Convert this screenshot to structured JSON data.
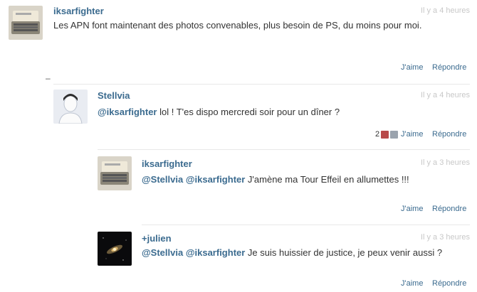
{
  "comments": [
    {
      "author": "iksarfighter",
      "time": "Il y a 4 heures",
      "text": "Les APN font maintenant des photos convenables, plus besoin de PS, du moins pour moi.",
      "like_label": "J'aime",
      "reply_label": "Répondre"
    },
    {
      "author": "Stellvia",
      "time": "Il y a 4 heures",
      "mention1": "@iksarfighter",
      "text": " lol ! T'es dispo mercredi soir pour un dîner ?",
      "like_count": "2",
      "like_label": "J'aime",
      "reply_label": "Répondre"
    },
    {
      "author": "iksarfighter",
      "time": "Il y a 3 heures",
      "mention1": "@Stellvia",
      "mention2": "@iksarfighter",
      "text": " J'amène ma Tour Effeil en allumettes !!!",
      "like_label": "J'aime",
      "reply_label": "Répondre"
    },
    {
      "author": "+julien",
      "time": "Il y a 3 heures",
      "mention1": "@Stellvia",
      "mention2": "@iksarfighter",
      "text": " Je suis huissier de justice, je peux venir aussi ?",
      "like_label": "J'aime",
      "reply_label": "Répondre"
    }
  ],
  "collapse_symbol": "–",
  "colors": {
    "link": "#3b6b8f",
    "muted": "#c8c8c8"
  },
  "icons": [
    "computer-avatar-icon",
    "person-avatar-icon",
    "galaxy-avatar-icon"
  ]
}
